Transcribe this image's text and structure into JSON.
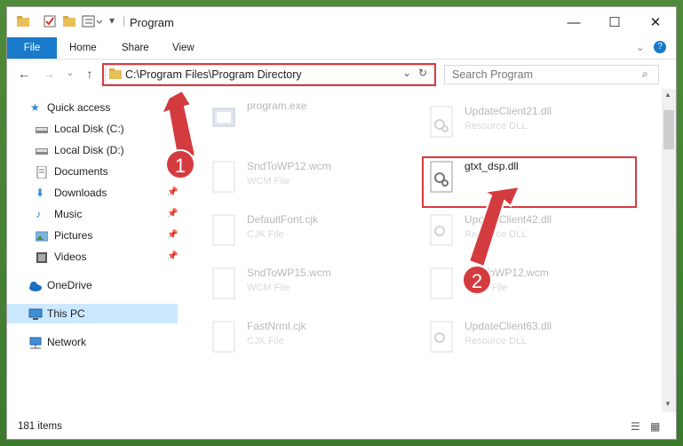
{
  "window": {
    "title": "Program"
  },
  "ribbon": {
    "tabs": [
      "File",
      "Home",
      "Share",
      "View"
    ]
  },
  "address": {
    "path": "C:\\Program Files\\Program Directory"
  },
  "search": {
    "placeholder": "Search Program"
  },
  "nav": {
    "items": [
      {
        "label": "Quick access",
        "icon": "star-icon"
      },
      {
        "label": "Local Disk (C:)",
        "icon": "drive-icon"
      },
      {
        "label": "Local Disk (D:)",
        "icon": "drive-icon"
      },
      {
        "label": "Documents",
        "icon": "documents-icon"
      },
      {
        "label": "Downloads",
        "icon": "downloads-icon"
      },
      {
        "label": "Music",
        "icon": "music-icon"
      },
      {
        "label": "Pictures",
        "icon": "pictures-icon"
      },
      {
        "label": "Videos",
        "icon": "videos-icon"
      },
      {
        "label": "OneDrive",
        "icon": "cloud-icon"
      },
      {
        "label": "This PC",
        "icon": "computer-icon"
      },
      {
        "label": "Network",
        "icon": "network-icon"
      }
    ]
  },
  "files": [
    {
      "name": "program.exe",
      "type": ""
    },
    {
      "name": "UpdateClient21.dll",
      "type": "Resource DLL"
    },
    {
      "name": "SndToWP12.wcm",
      "type": "WCM File"
    },
    {
      "name": "gtxt_dsp.dll",
      "type": ""
    },
    {
      "name": "DefaultFont.cjk",
      "type": "CJK File"
    },
    {
      "name": "UpdateClient42.dll",
      "type": "Resource DLL"
    },
    {
      "name": "SndToWP15.wcm",
      "type": "WCM File"
    },
    {
      "name": "SndToWP12.wcm",
      "type": "WCM File"
    },
    {
      "name": "FastNrml.cjk",
      "type": "CJK File"
    },
    {
      "name": "UpdateClient63.dll",
      "type": "Resource DLL"
    }
  ],
  "status": {
    "item_count": "181 items"
  },
  "callouts": {
    "one": "1",
    "two": "2"
  },
  "colors": {
    "accent": "#1979ca",
    "highlight": "#d9393f",
    "selection": "#cce8ff"
  }
}
